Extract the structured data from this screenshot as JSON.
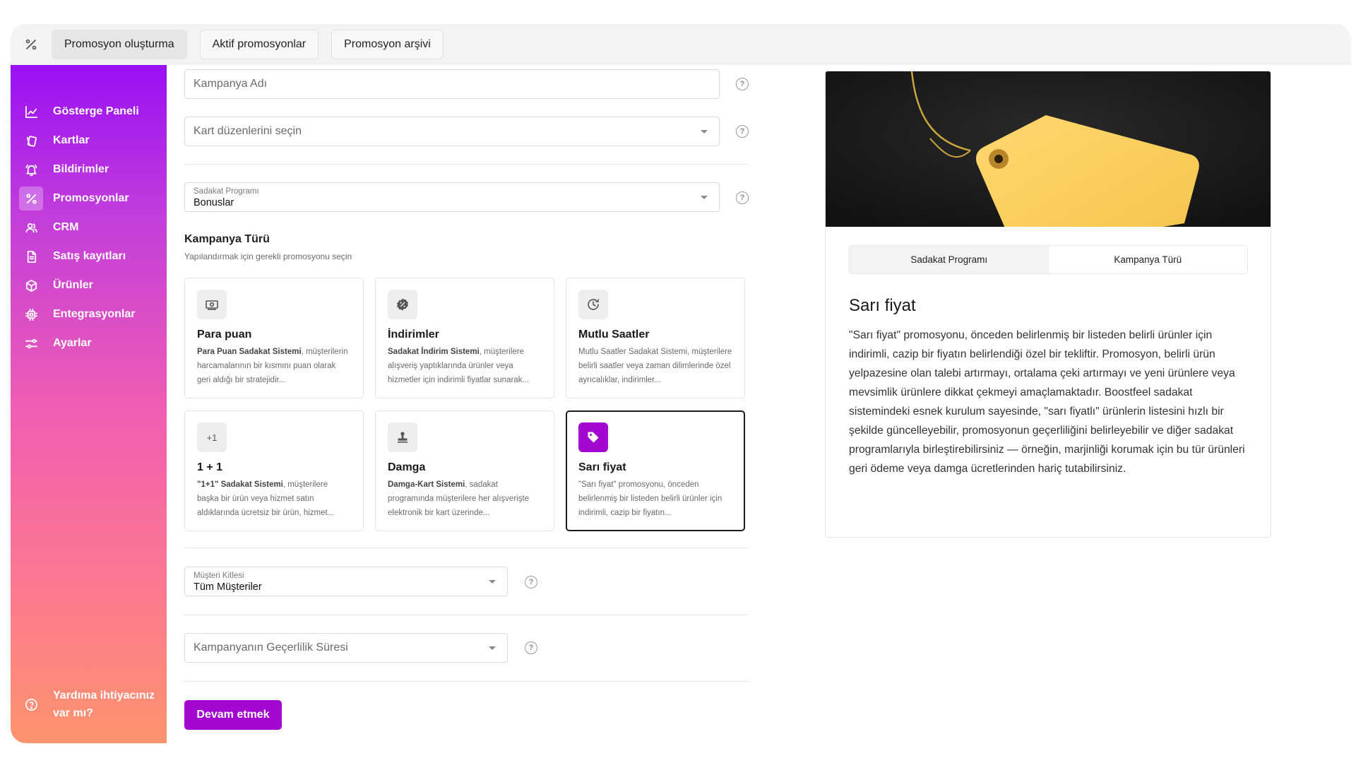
{
  "topbar": {
    "icon": "percent-icon",
    "tabs": [
      {
        "label": "Promosyon oluşturma",
        "active": true
      },
      {
        "label": "Aktif promosyonlar",
        "active": false
      },
      {
        "label": "Promosyon arşivi",
        "active": false
      }
    ]
  },
  "sidebar": {
    "items": [
      {
        "label": "Gösterge Paneli",
        "icon": "chart-line-icon"
      },
      {
        "label": "Kartlar",
        "icon": "cards-icon"
      },
      {
        "label": "Bildirimler",
        "icon": "bell-icon"
      },
      {
        "label": "Promosyonlar",
        "icon": "percent-icon",
        "active": true
      },
      {
        "label": "CRM",
        "icon": "users-icon"
      },
      {
        "label": "Satış kayıtları",
        "icon": "document-icon"
      },
      {
        "label": "Ürünler",
        "icon": "box-icon"
      },
      {
        "label": "Entegrasyonlar",
        "icon": "chip-icon"
      },
      {
        "label": "Ayarlar",
        "icon": "sliders-icon"
      }
    ],
    "help_line1": "Yardıma ihtiyacınız",
    "help_line2": "var mı?"
  },
  "form": {
    "campaign_name_placeholder": "Kampanya Adı",
    "card_layouts_placeholder": "Kart düzenlerini seçin",
    "loyalty_program": {
      "label": "Sadakat Programı",
      "value": "Bonuslar"
    },
    "campaign_type_title": "Kampanya Türü",
    "campaign_type_subtitle": "Yapılandırmak için gerekli promosyonu seçin",
    "cards": [
      {
        "title": "Para puan",
        "bold": "Para Puan Sadakat Sistemi",
        "desc": ", müşterilerin harcamalarının bir kısmını puan olarak geri aldığı bir stratejidir...",
        "icon": "cash-icon"
      },
      {
        "title": "İndirimler",
        "bold": "Sadakat İndirim Sistemi",
        "desc": ", müşterilere alışveriş yaptıklarında ürünler veya hizmetler için indirimli fiyatlar sunarak...",
        "icon": "discount-badge-icon"
      },
      {
        "title": "Mutlu Saatler",
        "bold": "",
        "desc": "Mutlu Saatler Sadakat Sistemi, müşterilere belirli saatler veya zaman dilimlerinde özel ayrıcalıklar, indirimler...",
        "icon": "clock-icon"
      },
      {
        "title": "1 + 1",
        "bold": "\"1+1\" Sadakat Sistemi",
        "desc": ", müşterilere başka bir ürün veya hizmet satın aldıklarında ücretsiz bir ürün, hizmet...",
        "icon": "plus-one-icon",
        "icon_text": "+1"
      },
      {
        "title": "Damga",
        "bold": "Damga-Kart Sistemi",
        "desc": ", sadakat programında müşterilere her alışverişte elektronik bir kart üzerinde...",
        "icon": "stamp-icon"
      },
      {
        "title": "Sarı fiyat",
        "bold": "",
        "desc": "\"Sarı fiyat\" promosyonu, önceden belirlenmiş bir listeden belirli ürünler için indirimli, cazip bir fiyatın...",
        "icon": "tag-icon",
        "selected": true
      }
    ],
    "audience": {
      "label": "Müşteri Kitlesi",
      "value": "Tüm Müşteriler"
    },
    "validity_placeholder": "Kampanyanın Geçerlilik Süresi",
    "continue_label": "Devam etmek"
  },
  "preview": {
    "tabs": [
      "Sadakat Programı",
      "Kampanya Türü"
    ],
    "title": "Sarı fiyat",
    "text": "\"Sarı fiyat\" promosyonu, önceden belirlenmiş bir listeden belirli ürünler için indirimli, cazip bir fiyatın belirlendiği özel bir tekliftir. Promosyon, belirli ürün yelpazesine olan talebi artırmayı, ortalama çeki artırmayı ve yeni ürünlere veya mevsimlik ürünlere dikkat çekmeyi amaçlamaktadır. Boostfeel sadakat sistemindeki esnek kurulum sayesinde, \"sarı fiyatlı\" ürünlerin listesini hızlı bir şekilde güncelleyebilir, promosyonun geçerliliğini belirleyebilir ve diğer sadakat programlarıyla birleştirebilirsiniz — örneğin, marjinliği korumak için bu tür ürünleri geri ödeme veya damga ücretlerinden hariç tutabilirsiniz.",
    "accent": "#a308d0"
  }
}
